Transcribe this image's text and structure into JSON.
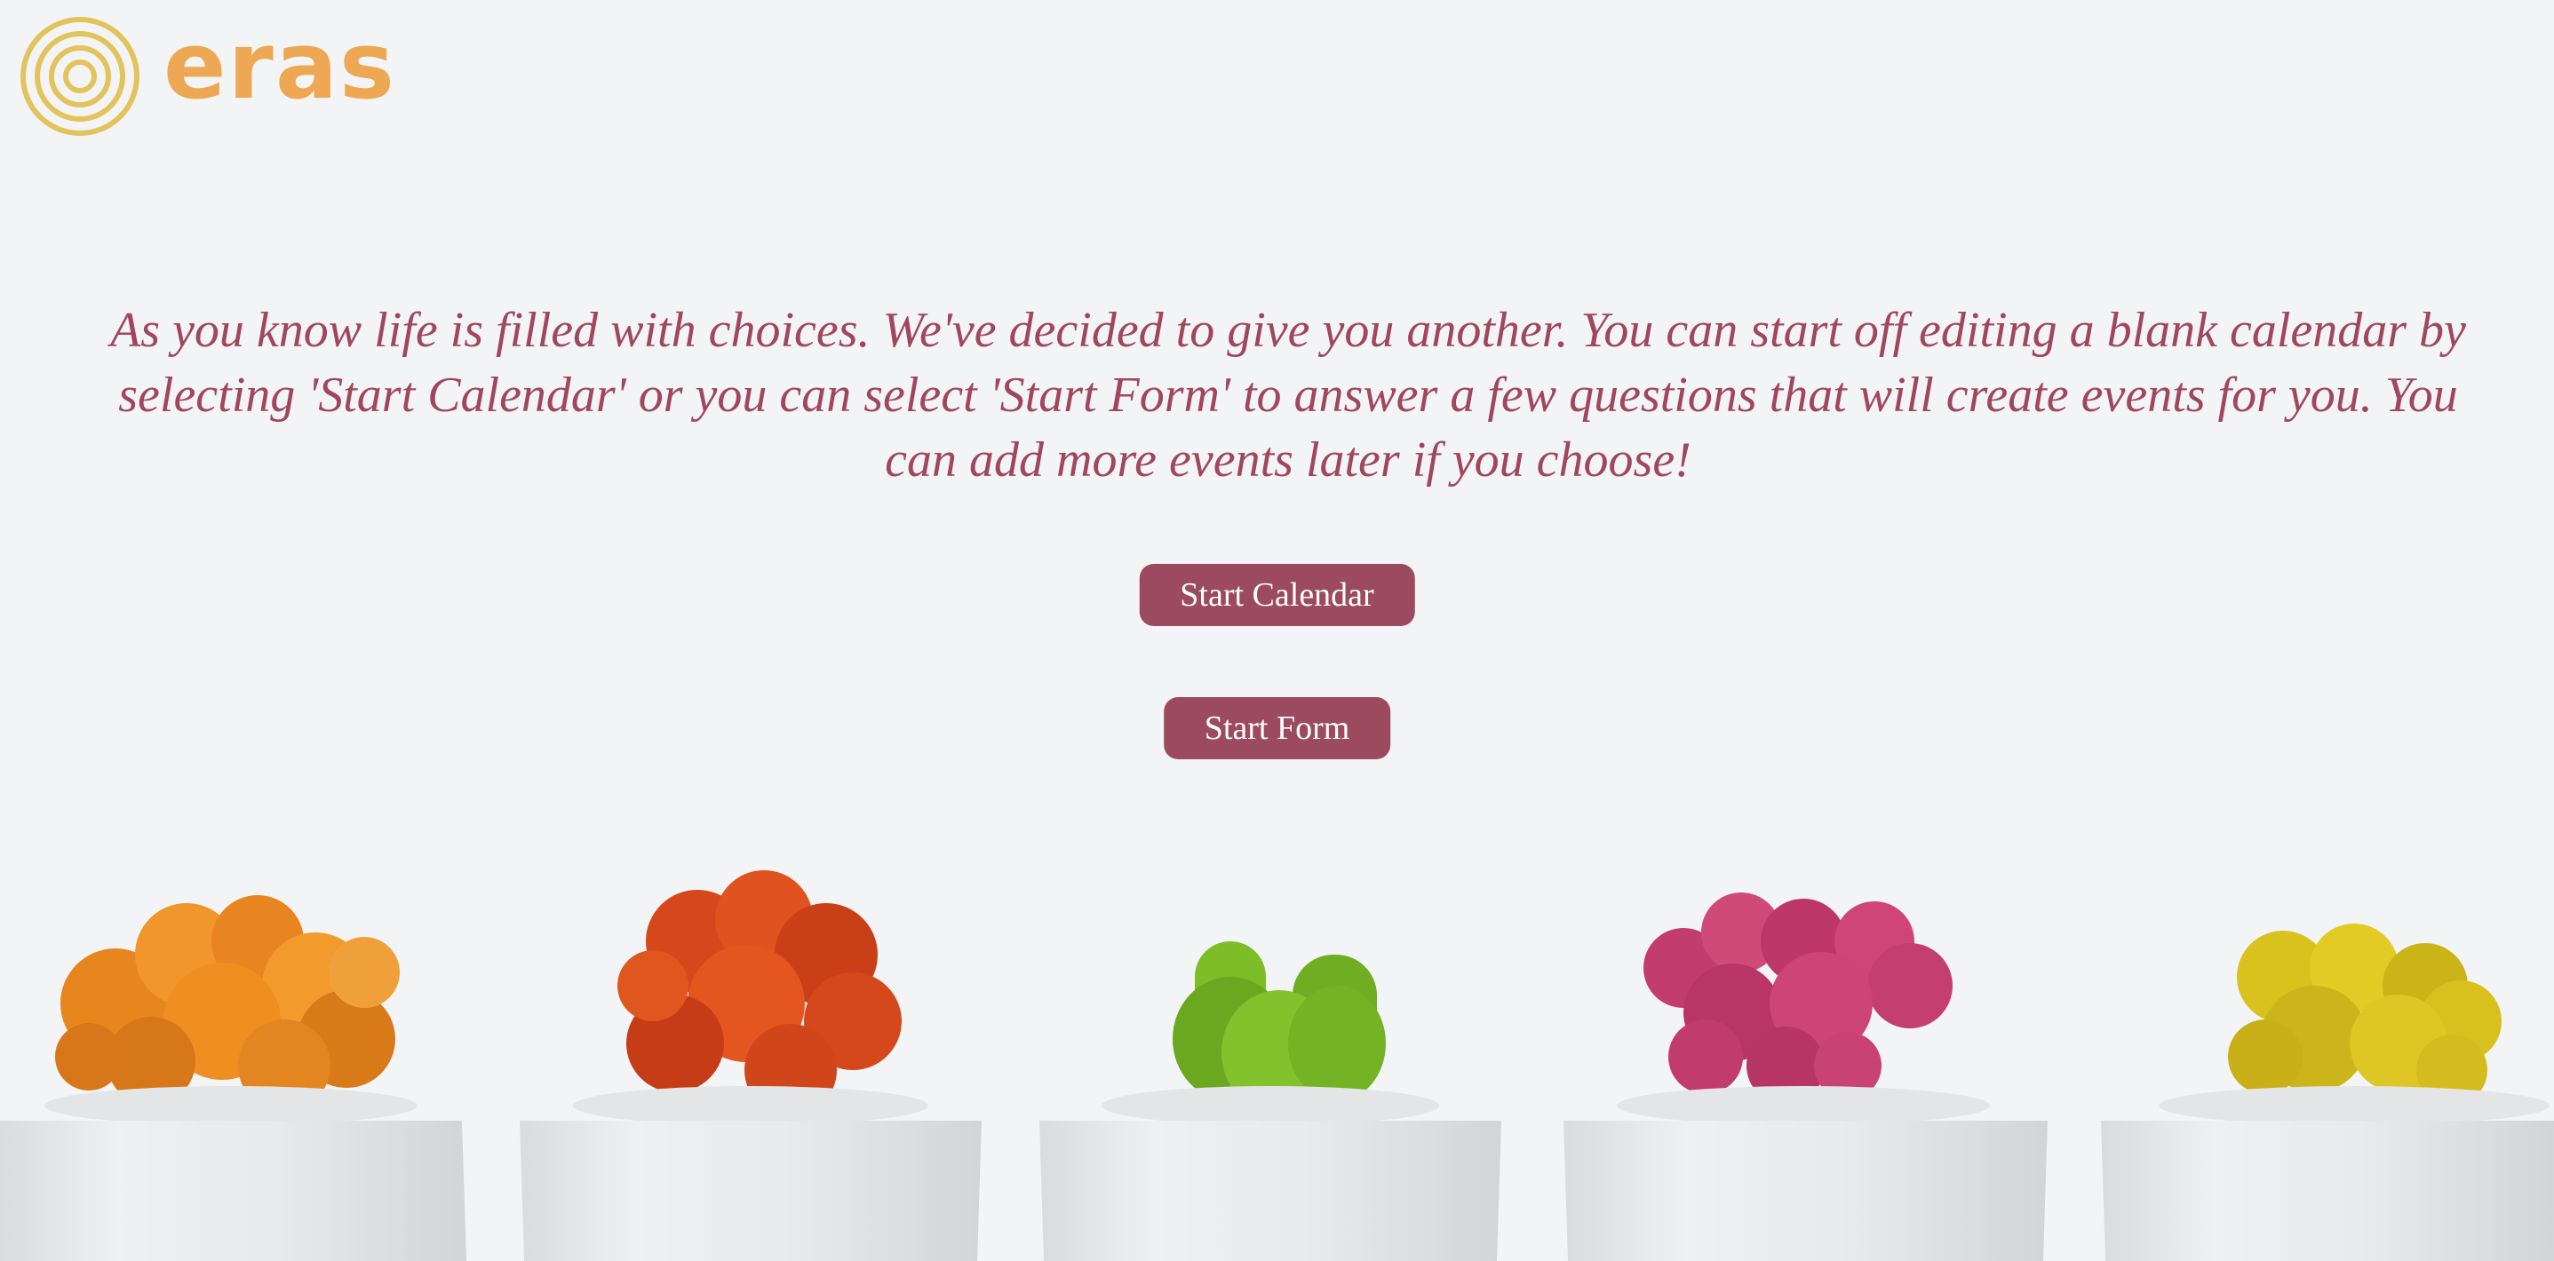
{
  "brand": {
    "name": "eras",
    "logo_icon": "concentric-circles-icon",
    "logo_color": "#e2c35c",
    "text_color": "#eea854"
  },
  "intro": {
    "text": "As you know life is filled with choices. We've decided to give you another. You can start off editing a blank calendar by selecting 'Start Calendar' or you can select 'Start Form' to answer a few questions that will create events for you. You can add more events later if you choose!"
  },
  "actions": {
    "start_calendar_label": "Start Calendar",
    "start_form_label": "Start Form"
  },
  "colors": {
    "accent": "#9c4a60",
    "background": "#f3f4f5"
  },
  "background_image": {
    "subject": "row of five potted cacti in white pots",
    "cactus_colors": [
      "#e8851f",
      "#d9461a",
      "#7fbc2a",
      "#c23c6d",
      "#d9c21d"
    ]
  }
}
